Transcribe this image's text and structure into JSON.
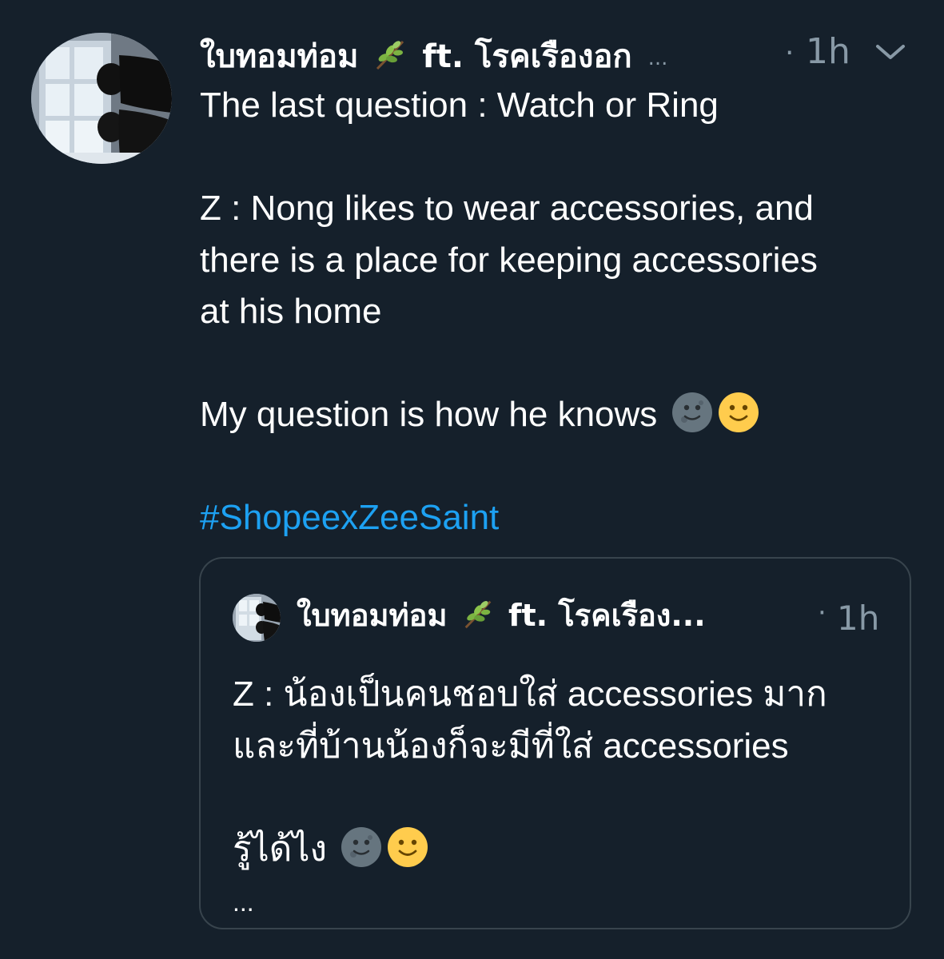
{
  "tweet": {
    "author_name": "ใบทอมท่อม",
    "author_emoji": "herb-emoji",
    "author_name_rest": "ft. โรคเรืองอก",
    "author_name_overflow": "...",
    "separator": "·",
    "timestamp": "1h",
    "menu_icon": "chevron-down-icon",
    "lines": [
      "The last question : Watch or Ring",
      "Z : Nong likes to wear accessories, and",
      "there is a place for keeping accessories",
      "at his home",
      "My question is how he knows"
    ],
    "hashtag": "#ShopeexZeeSaint"
  },
  "quoted_tweet": {
    "author_name": "ใบทอมท่อม",
    "author_emoji": "herb-emoji",
    "author_name_rest": "ft. โรคเรือง...",
    "separator": "·",
    "timestamp": "1h",
    "lines": [
      "Z : น้องเป็นคนชอบใส่ accessories มาก",
      "และที่บ้านน้องก็จะมีที่ใส่ accessories",
      "รู้ได้ไง"
    ],
    "show_more": "..."
  },
  "colors": {
    "background": "#15202b",
    "text": "#ffffff",
    "muted": "#8899a6",
    "link": "#1da1f2",
    "border": "#38444d"
  }
}
